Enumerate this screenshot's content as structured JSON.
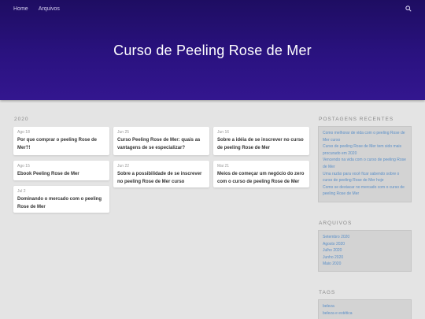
{
  "nav": {
    "home": "Home",
    "archives": "Arquivos"
  },
  "header": {
    "title": "Curso de Peeling Rose de Mer"
  },
  "main": {
    "year": "2020",
    "posts": [
      {
        "date": "Ago 18",
        "title": "Por que comprar o peeling Rose de Mer?!"
      },
      {
        "date": "Jun 25",
        "title": "Curso Peeling Rose de Mer: quais as vantagens de se especializar?"
      },
      {
        "date": "Jun 16",
        "title": "Sobre a idéia de se inscrever no curso de peeling Rose de Mer"
      },
      {
        "date": "Ago 15",
        "title": "Ebook Peeling Rose de Mer"
      },
      {
        "date": "Jun 22",
        "title": "Sobre a possibilidade de se inscrever no peeling Rose de Mer curso"
      },
      {
        "date": "Mai 21",
        "title": "Meios de começar um negócio do zero com o curso de peeling Rose de Mer"
      },
      {
        "date": "Jul 2",
        "title": "Dominando o mercado com o peeling Rose de Mer"
      }
    ]
  },
  "sidebar": {
    "recent": {
      "heading": "POSTAGENS RECENTES",
      "items": [
        "Como melhorar de vida com o peeling Rose de Mer curso",
        "Curso de peeling Rose de Mer tem sido mais procurado em 2020",
        "Vencendo na vida com o curso de peeling Rose de Mer",
        "Uma razão para você ficar sabendo sobre o curso de peeling Rose de Mer hoje",
        "Como se destacar no mercado com o curso de peeling Rose de Mer"
      ]
    },
    "archives": {
      "heading": "ARQUIVOS",
      "items": [
        "Setembro 2020",
        "Agosto 2020",
        "Julho 2020",
        "Junho 2020",
        "Maio 2020"
      ]
    },
    "tags": {
      "heading": "TAGS",
      "items": [
        "beleza",
        "beleza e estética"
      ]
    }
  },
  "colors": {
    "hero": "#2a1280",
    "link": "#5a8fc8",
    "background": "#e4e4e4"
  },
  "icons": {
    "search": "search-icon"
  }
}
